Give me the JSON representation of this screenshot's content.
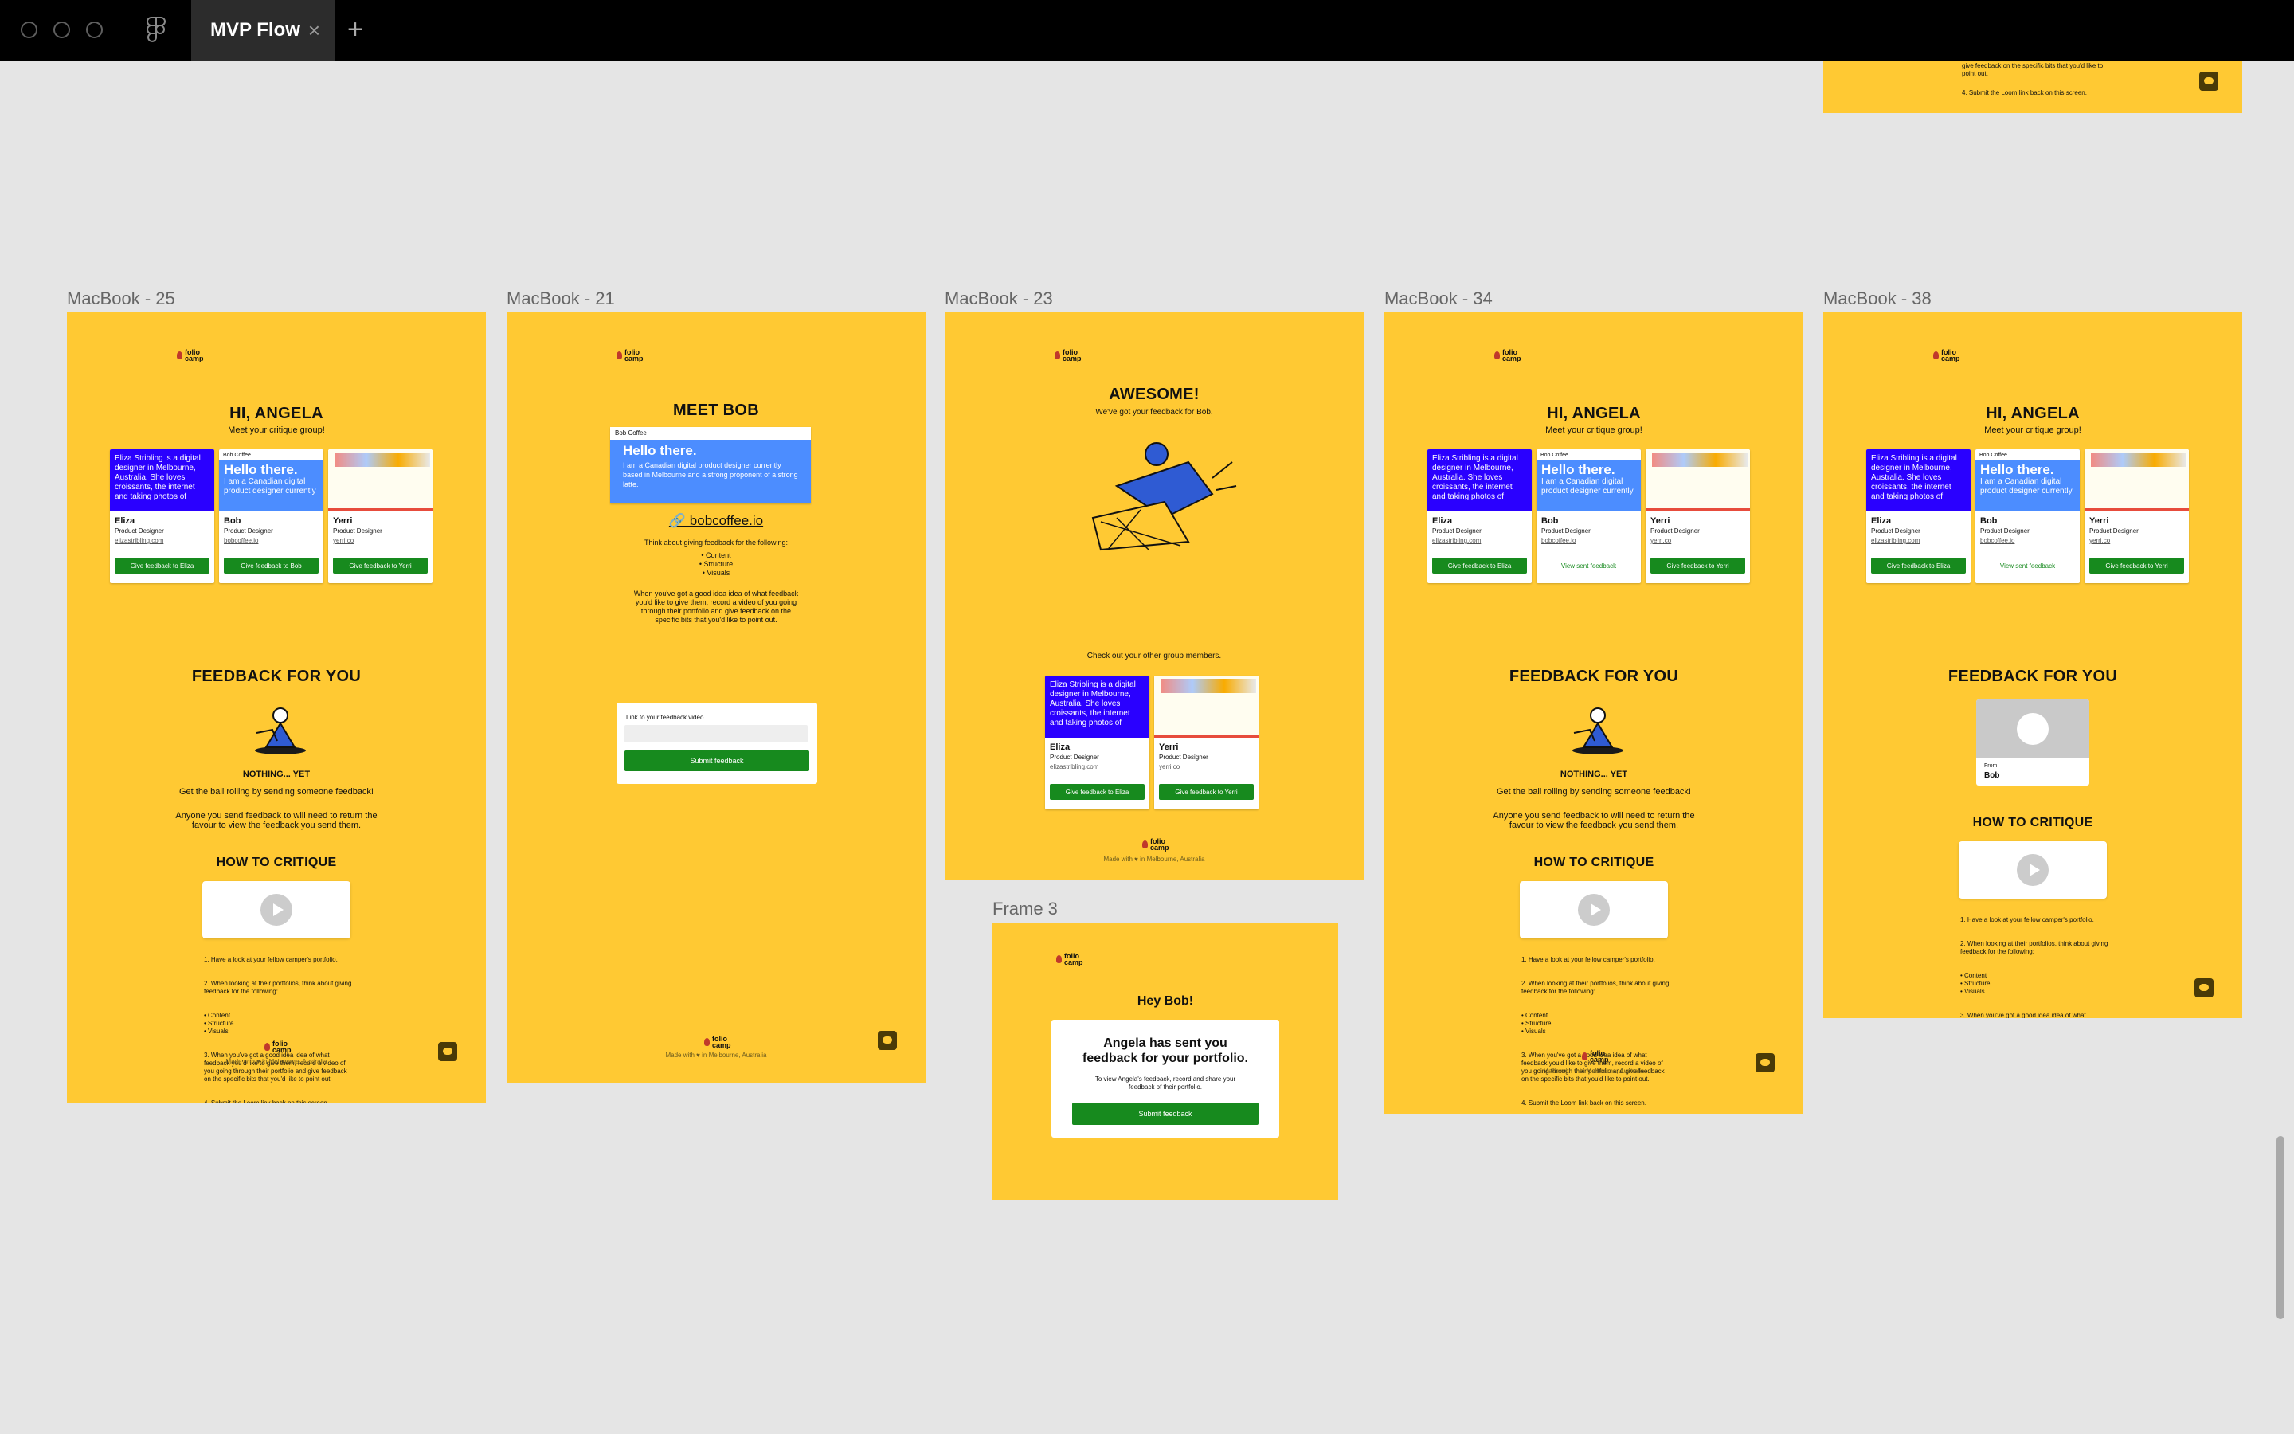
{
  "app": {
    "tab_title": "MVP Flow",
    "tab_close": "×",
    "new_tab": "+"
  },
  "logo": {
    "line1": "folio",
    "line2": "camp"
  },
  "common": {
    "hi": "HI, ANGELA",
    "meet": "Meet your critique group!",
    "feedback_for_you": "FEEDBACK FOR YOU",
    "nothing_yet": "NOTHING... YET",
    "get_ball": "Get the ball rolling by sending someone feedback!",
    "anyone": "Anyone you send feedback to will need to return the favour to view the feedback you send them.",
    "how_to": "HOW TO CRITIQUE",
    "steps": [
      "1. Have a look at your fellow camper's portfolio.",
      "2. When looking at their portfolios, think about giving feedback for the following:",
      "• Content\n• Structure\n• Visuals",
      "3. When you've got a good idea idea of what feedback you'd like to give them, record a video of you going through their portfolio and give feedback on the specific bits that you'd like to point out.",
      "4. Submit the Loom link back on this screen."
    ],
    "made_with": "Made with ♥ in Melbourne, Australia"
  },
  "members": {
    "eliza": {
      "name": "Eliza",
      "role": "Product Designer",
      "link": "elizastribling.com",
      "blurb": "Eliza Stribling is a digital designer in Melbourne, Australia. She loves croissants, the internet and taking photos of",
      "btn": "Give feedback to Eliza"
    },
    "bob": {
      "name": "Bob",
      "role": "Product Designer",
      "link": "bobcoffee.io",
      "header": "Bob Coffee",
      "hello": "Hello there.",
      "blurb": "I am a Canadian digital product designer currently",
      "btn": "Give feedback to Bob",
      "btn_sent": "View sent feedback"
    },
    "yerri": {
      "name": "Yerri",
      "role": "Product Designer",
      "link": "yerri.co",
      "btn": "Give feedback to Yerri"
    }
  },
  "frames": {
    "f25": {
      "label": "MacBook - 25"
    },
    "f21": {
      "label": "MacBook - 21",
      "title": "MEET BOB",
      "browser_title": "Bob Coffee",
      "hello": "Hello there.",
      "bio": "I am a Canadian digital product designer currently based in Melbourne and a strong proponent of a strong latte.",
      "site": "🔗 bobcoffee.io",
      "think": "Think about giving feedback for the following:",
      "list": "• Content\n• Structure\n• Visuals",
      "when": "When you've got a good idea idea of what feedback you'd like to give them, record a video of you going through their portfolio and give feedback on the specific bits that you'd like to point out.",
      "input_label": "Link to your feedback video",
      "submit": "Submit feedback"
    },
    "f23": {
      "label": "MacBook - 23",
      "title": "AWESOME!",
      "sub": "We've got your feedback for Bob.",
      "check": "Check out your other group members."
    },
    "f34": {
      "label": "MacBook - 34"
    },
    "f38": {
      "label": "MacBook - 38",
      "from": "From",
      "from_name": "Bob"
    },
    "frame3": {
      "label": "Frame 3",
      "hey": "Hey Bob!",
      "msg": "Angela has sent you feedback for your portfolio.",
      "detail": "To view Angela's feedback, record and share your feedback of their portfolio.",
      "submit": "Submit feedback"
    },
    "top": {
      "tail": "give feedback on the specific bits that you'd like to point out.",
      "step4": "4. Submit the Loom link back on this screen."
    }
  }
}
